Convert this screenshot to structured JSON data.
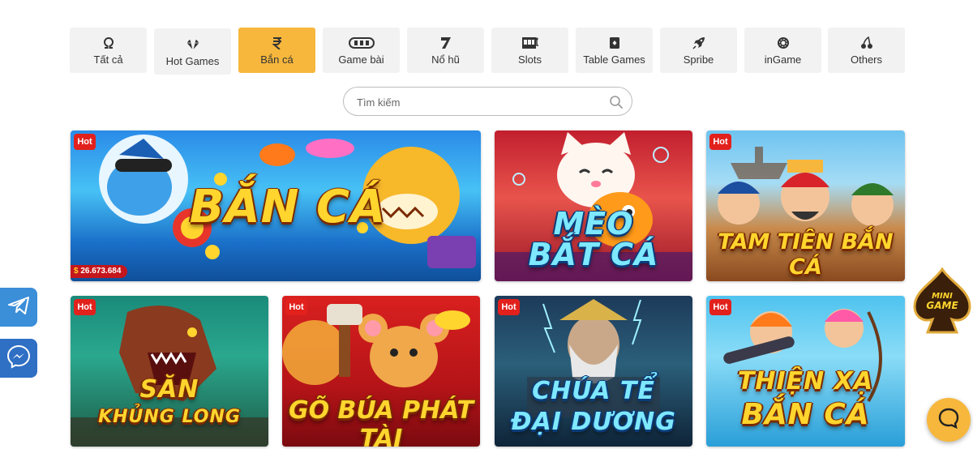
{
  "tabs": [
    {
      "label": "Tất cả",
      "icon": "omega-icon",
      "active": false
    },
    {
      "label": "Hot Games",
      "icon": "diamond-icon",
      "active": false
    },
    {
      "label": "Bắn cá",
      "icon": "rupee-icon",
      "active": true
    },
    {
      "label": "Game bài",
      "icon": "cards-icon",
      "active": false
    },
    {
      "label": "Nổ hũ",
      "icon": "seven-icon",
      "active": false
    },
    {
      "label": "Slots",
      "icon": "slot-machine-icon",
      "active": false
    },
    {
      "label": "Table Games",
      "icon": "table-cards-icon",
      "active": false
    },
    {
      "label": "Spribe",
      "icon": "rocket-icon",
      "active": false
    },
    {
      "label": "inGame",
      "icon": "chip-icon",
      "active": false
    },
    {
      "label": "Others",
      "icon": "cherry-icon",
      "active": false
    }
  ],
  "search": {
    "placeholder": "Tìm kiếm",
    "value": ""
  },
  "games": [
    {
      "title_line1": "BẮN CÁ",
      "title_line2": "",
      "badge": "Hot",
      "jackpot_currency": "$",
      "jackpot": "26.673.684"
    },
    {
      "title_line1": "MÈO",
      "title_line2": "BẮT CÁ",
      "badge": "",
      "jackpot": ""
    },
    {
      "title_line1": "TAM TIÊN BẮN CÁ",
      "title_line2": "",
      "badge": "Hot",
      "jackpot": ""
    },
    {
      "title_line1": "SĂN",
      "title_line2": "KHỦNG LONG",
      "badge": "Hot",
      "jackpot": ""
    },
    {
      "title_line1": "GÕ BÚA PHÁT TÀI",
      "title_line2": "",
      "badge": "Hot",
      "jackpot": ""
    },
    {
      "title_line1": "CHÚA TỂ",
      "title_line2": "ĐẠI DƯƠNG",
      "badge": "Hot",
      "jackpot": ""
    },
    {
      "title_line1": "THIỆN XẠ",
      "title_line2": "BẮN CÁ",
      "badge": "Hot",
      "jackpot": ""
    }
  ],
  "mini_game": {
    "line1": "MINI",
    "line2": "GAME"
  },
  "colors": {
    "accent": "#f6b73c",
    "tab_bg": "#f2f2f2",
    "hot_badge": "#e2211c",
    "telegram": "#3b8ed8",
    "messenger": "#2f6fc4"
  }
}
